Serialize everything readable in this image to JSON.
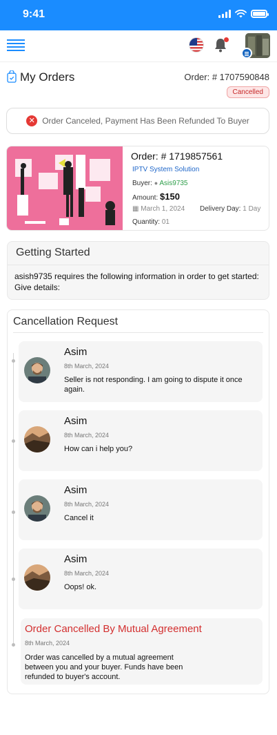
{
  "status_bar": {
    "time": "9:41"
  },
  "header": {
    "title": "My Orders",
    "order_number": "Order: # 1707590848",
    "status_badge": "Cancelled"
  },
  "alert": {
    "text": "Order Canceled, Payment Has Been Refunded To Buyer",
    "icon": "x-circle-icon"
  },
  "order_card": {
    "title": "Order: # 1719857561",
    "service": "IPTV System Solution",
    "buyer_label": "Buyer:",
    "buyer_name": "Asis9735",
    "amount_label": "Amount:",
    "amount": "$150",
    "date": "March 1, 2024",
    "delivery_label": "Delivery Day:",
    "delivery_value": "1 Day",
    "quantity_label": "Quantity:",
    "quantity_value": "01"
  },
  "getting_started": {
    "title": "Getting Started",
    "body": "asish9735 requires the following information in order to get started: Give details:"
  },
  "cancellation": {
    "title": "Cancellation Request",
    "messages": [
      {
        "name": "Asim",
        "date": "8th March, 2024",
        "text": "Seller is not responding. I am going to dispute it once again."
      },
      {
        "name": "Asim",
        "date": "8th March, 2024",
        "text": "How can i help you?"
      },
      {
        "name": "Asim",
        "date": "8th March, 2024",
        "text": "Cancel it"
      },
      {
        "name": "Asim",
        "date": "8th March, 2024",
        "text": "Oops! ok."
      }
    ],
    "final": {
      "title": "Order Cancelled By Mutual Agreement",
      "date": "8th March, 2024",
      "text": "Order was cancelled by a mutual agreement between you and your buyer. Funds have been refunded to buyer's account."
    }
  },
  "colors": {
    "primary": "#1a8cff",
    "danger": "#d32f2f",
    "success": "#2e9e4a",
    "link": "#1e66c9"
  }
}
